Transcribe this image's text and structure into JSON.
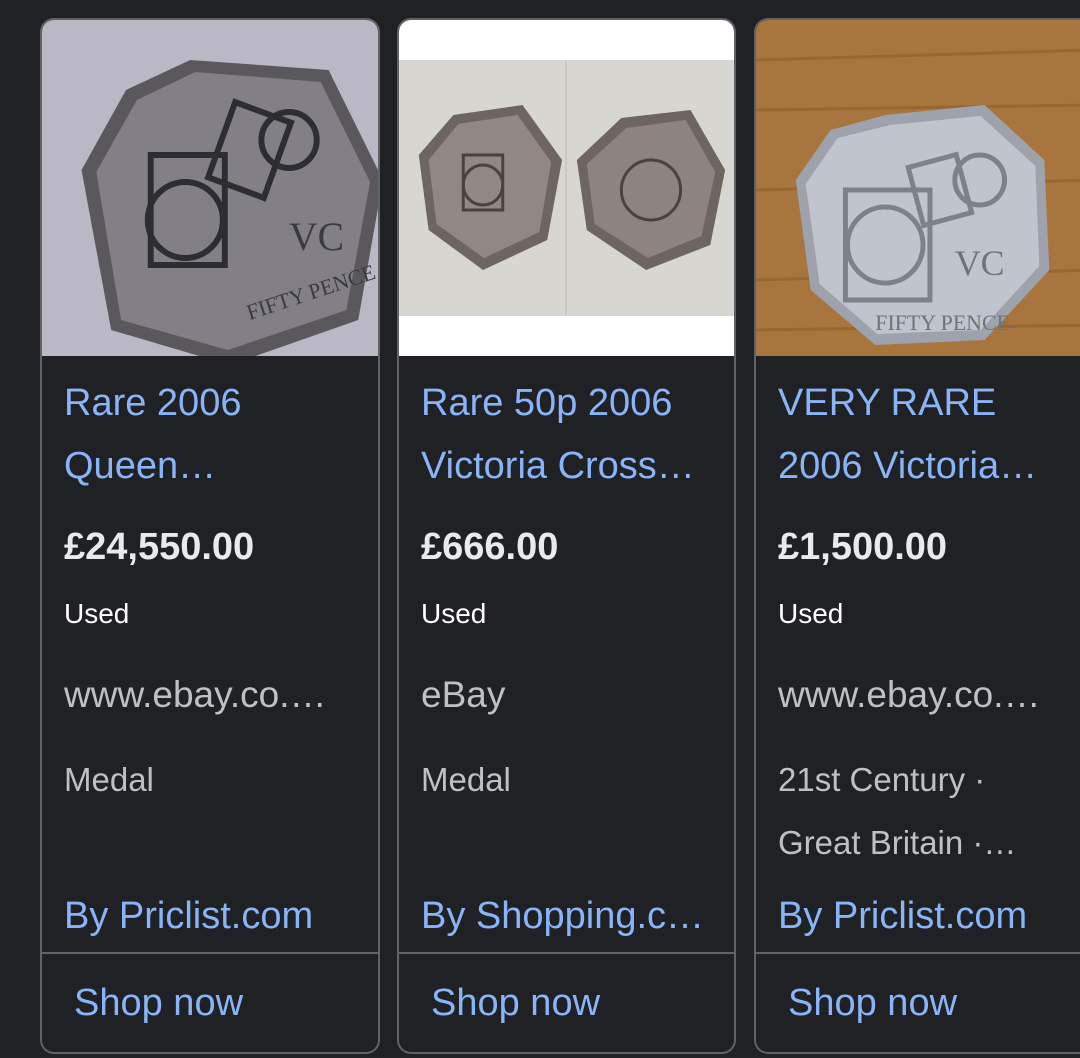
{
  "products": [
    {
      "title_line1": "Rare 2006",
      "title_line2": "Queen…",
      "price": "£24,550.00",
      "condition": "Used",
      "source": "www.ebay.co.…",
      "category_line1": "Medal",
      "category_line2": "",
      "seller": "By Priclist.com",
      "action": "Shop now"
    },
    {
      "title_line1": "Rare 50p 2006",
      "title_line2": "Victoria Cross…",
      "price": "£666.00",
      "condition": "Used",
      "source": "eBay",
      "category_line1": "Medal",
      "category_line2": "",
      "seller": "By Shopping.c…",
      "action": "Shop now"
    },
    {
      "title_line1": "VERY RARE",
      "title_line2": "2006 Victoria…",
      "price": "£1,500.00",
      "condition": "Used",
      "source": "www.ebay.co.…",
      "category_line1": "21st Century ·",
      "category_line2": "Great Britain ·…",
      "seller": "By Priclist.com",
      "action": "Shop now"
    }
  ],
  "colors": {
    "background": "#202124",
    "link": "#8ab4f8",
    "border": "#5f6368"
  }
}
